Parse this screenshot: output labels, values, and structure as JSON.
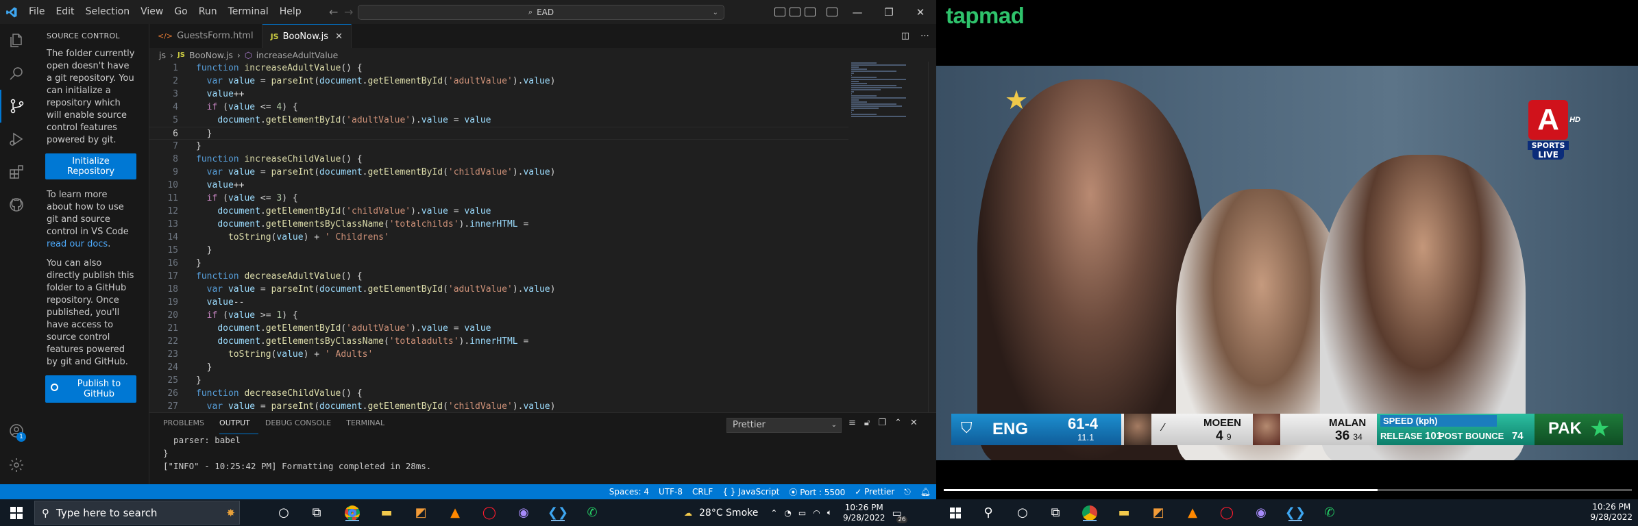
{
  "vscode": {
    "menu": [
      "File",
      "Edit",
      "Selection",
      "View",
      "Go",
      "Run",
      "Terminal",
      "Help"
    ],
    "command_center": "EAD",
    "sidebar": {
      "header": "SOURCE CONTROL",
      "text1": "The folder currently open doesn't have a git repository. You can initialize a repository which will enable source control features powered by git.",
      "init_button": "Initialize Repository",
      "text2_pre": "To learn more about how to use git and source control in VS Code ",
      "text2_link": "read our docs",
      "text2_post": ".",
      "text3": "You can also directly publish this folder to a GitHub repository. Once published, you'll have access to source control features powered by git and GitHub.",
      "publish_button": "Publish to GitHub",
      "accounts_badge": "1"
    },
    "tabs": [
      {
        "label": "GuestsForm.html",
        "icon": "html-file-icon"
      },
      {
        "label": "BooNow.js",
        "icon": "js-file-icon"
      }
    ],
    "breadcrumb": [
      "js",
      "BooNow.js",
      "increaseAdultValue"
    ],
    "code_lines": [
      "function increaseAdultValue() {",
      "  var value = parseInt(document.getElementById('adultValue').value)",
      "  value++",
      "  if (value <= 4) {",
      "    document.getElementById('adultValue').value = value",
      "  }",
      "}",
      "function increaseChildValue() {",
      "  var value = parseInt(document.getElementById('childValue').value)",
      "  value++",
      "  if (value <= 3) {",
      "    document.getElementById('childValue').value = value",
      "    document.getElementsByClassName('totalchilds').innerHTML =",
      "      toString(value) + ' Childrens'",
      "  }",
      "}",
      "function decreaseAdultValue() {",
      "  var value = parseInt(document.getElementById('adultValue').value)",
      "  value--",
      "  if (value >= 1) {",
      "    document.getElementById('adultValue').value = value",
      "    document.getElementsByClassName('totaladults').innerHTML =",
      "      toString(value) + ' Adults'",
      "  }",
      "}",
      "function decreaseChildValue() {",
      "  var value = parseInt(document.getElementById('childValue').value)"
    ],
    "panel": {
      "tabs": [
        "PROBLEMS",
        "OUTPUT",
        "DEBUG CONSOLE",
        "TERMINAL"
      ],
      "dropdown": "Prettier",
      "output_lines": [
        "  parser: babel",
        "}",
        "[\"INFO\" - 10:25:42 PM] Formatting completed in 28ms."
      ]
    },
    "status": {
      "spaces": "Spaces: 4",
      "encoding": "UTF-8",
      "eol": "CRLF",
      "language": "JavaScript",
      "port": "Port : 5500",
      "formatter": "Prettier"
    }
  },
  "tapmad": {
    "brand": "tapmad",
    "channel": {
      "letter": "A",
      "hd": "HD",
      "sports": "SPORTS",
      "live": "LIVE"
    },
    "score": {
      "team1": "ENG",
      "runs": "61-4",
      "overs": "11.1",
      "bat1_name": "MOEEN",
      "bat1_runs": "4",
      "bat1_balls": "9",
      "bat2_name": "MALAN",
      "bat2_runs": "36",
      "bat2_balls": "34",
      "speed_label": "SPEED (kph)",
      "release_label": "RELEASE",
      "release_value": "101",
      "bounce_label": "POST BOUNCE",
      "bounce_value": "74",
      "team2": "PAK"
    },
    "progress": 0.63
  },
  "taskbar": {
    "search_placeholder": "Type here to search",
    "weather": "28°C  Smoke",
    "time_left": "10:26 PM",
    "date_left": "9/28/2022",
    "notif_count": "26",
    "time_right": "10:26 PM",
    "date_right": "9/28/2022"
  }
}
